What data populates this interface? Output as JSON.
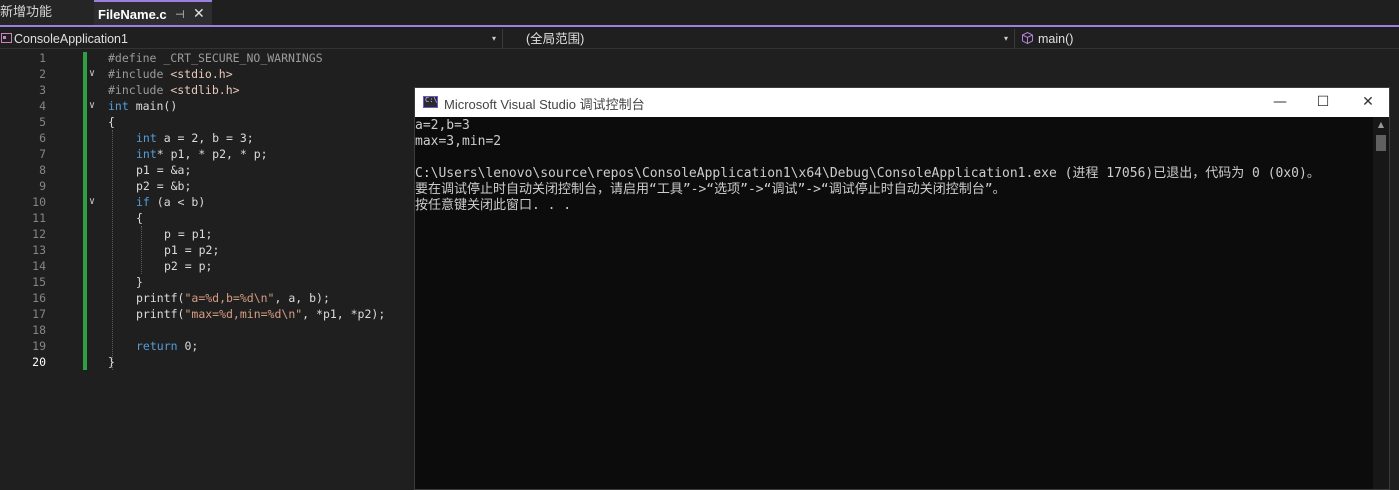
{
  "tabs": {
    "prev_label": "新增功能",
    "active_label": "FileName.c",
    "pin_glyph": "⊣",
    "close_glyph": "✕"
  },
  "navbar": {
    "project": "ConsoleApplication1",
    "scope": "(全局范围)",
    "member": "main()",
    "dropdown_glyph": "▾"
  },
  "editor": {
    "line_numbers": [
      "1",
      "2",
      "3",
      "4",
      "5",
      "6",
      "7",
      "8",
      "9",
      "10",
      "11",
      "12",
      "13",
      "14",
      "15",
      "16",
      "17",
      "18",
      "19",
      "20"
    ],
    "current_line": "20",
    "fold_glyph": "∨",
    "lines": {
      "l1_pp": "#define _CRT_SECURE_NO_WARNINGS",
      "l2_pp": "#include ",
      "l2_inc": "<stdio.h>",
      "l3_pp": "#include ",
      "l3_inc": "<stdlib.h>",
      "l4_kw": "int",
      "l4_rest": " main()",
      "l5": "{",
      "l6_kw": "int",
      "l6_rest": " a = 2, b = 3;",
      "l7_kw": "int",
      "l7_rest": "* p1, * p2, * p;",
      "l8": "p1 = &a;",
      "l9": "p2 = &b;",
      "l10_kw": "if",
      "l10_rest": " (a < b)",
      "l11": "{",
      "l12": "p = p1;",
      "l13": "p1 = p2;",
      "l14": "p2 = p;",
      "l15": "}",
      "l16_a": "printf(",
      "l16_str": "\"a=%d,b=%d\\n\"",
      "l16_b": ", a, b);",
      "l17_a": "printf(",
      "l17_str": "\"max=%d,min=%d\\n\"",
      "l17_b": ", *p1, *p2);",
      "l19_kw": "return",
      "l19_rest": " 0;",
      "l20": "}"
    }
  },
  "console": {
    "title": "Microsoft Visual Studio 调试控制台",
    "icon_text": "C:\\",
    "minimize_glyph": "—",
    "maximize_glyph": "☐",
    "close_glyph": "✕",
    "lines": [
      "a=2,b=3",
      "max=3,min=2",
      "",
      "C:\\Users\\lenovo\\source\\repos\\ConsoleApplication1\\x64\\Debug\\ConsoleApplication1.exe (进程 17056)已退出，代码为 0 (0x0)。",
      "要在调试停止时自动关闭控制台，请启用“工具”->“选项”->“调试”->“调试停止时自动关闭控制台”。",
      "按任意键关闭此窗口. . ."
    ],
    "scroll_up_glyph": "▲"
  }
}
